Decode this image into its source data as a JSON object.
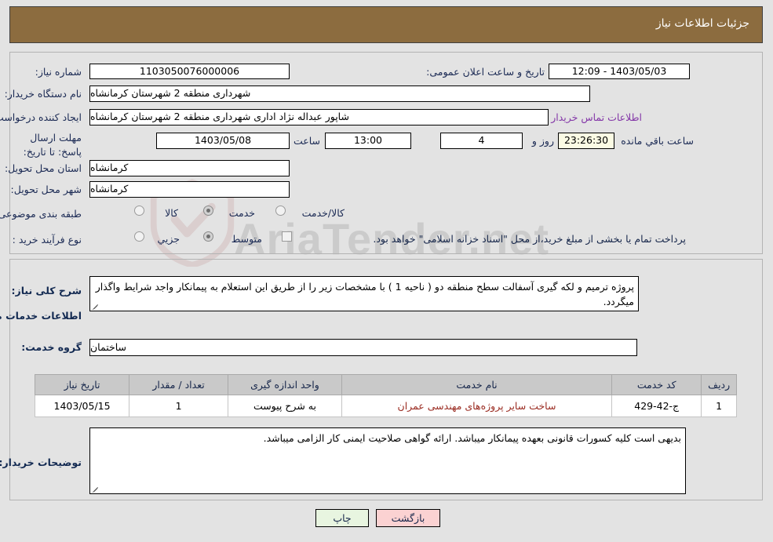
{
  "header": {
    "title": "جزئیات اطلاعات نیاز"
  },
  "form": {
    "need_number_label": "شماره نیاز:",
    "need_number_value": "1103050076000006",
    "public_announce_label": "تاریخ و ساعت اعلان عمومی:",
    "public_announce_value": "1403/05/03 - 12:09",
    "buyer_org_label": "نام دستگاه خریدار:",
    "buyer_org_value": "شهرداری منطقه 2 شهرستان کرمانشاه",
    "creator_label": "ایجاد کننده درخواست:",
    "creator_value": "شاپور عبداله نژاد اداری شهرداری منطقه 2 شهرستان کرمانشاه",
    "buyer_contact_link": "اطلاعات تماس خریدار",
    "deadline_label": "مهلت ارسال پاسخ: تا تاریخ:",
    "deadline_date": "1403/05/08",
    "hour_label": "ساعت",
    "deadline_time": "13:00",
    "days_remaining": "4",
    "days_label": "روز و",
    "time_remaining": "23:26:30",
    "remaining_suffix": "ساعت باقي مانده",
    "province_label": "استان محل تحویل:",
    "province_value": "کرمانشاه",
    "city_label": "شهر محل تحویل:",
    "city_value": "کرمانشاه",
    "category_label": "طبقه بندی موضوعی:",
    "category_options": [
      {
        "label": "کالا",
        "selected": false
      },
      {
        "label": "خدمت",
        "selected": true
      },
      {
        "label": "کالا/خدمت",
        "selected": false
      }
    ],
    "process_label": "نوع فرآیند خرید :",
    "process_options": [
      {
        "label": "جزیي",
        "selected": false
      },
      {
        "label": "متوسط",
        "selected": true
      }
    ],
    "treasury_checkbox_label": "پرداخت تمام یا بخشی از مبلغ خرید،از محل \"اسناد خزانه اسلامی\" خواهد بود.",
    "treasury_checked": false
  },
  "description": {
    "label": "شرح کلی نیاز:",
    "value": "پروژه ترمیم و لکه گیری آسفالت سطح منطقه دو ( ناحیه 1 )  با مشخصات زیر را از طریق این استعلام به پیمانکار واجد شرایط واگذار میگردد."
  },
  "services": {
    "section_title": "اطلاعات خدمات مورد نیاز",
    "group_label": "گروه خدمت:",
    "group_value": "ساختمان",
    "table": {
      "columns": [
        "ردیف",
        "کد خدمت",
        "نام خدمت",
        "واحد اندازه گیری",
        "تعداد / مقدار",
        "تاریخ نیاز"
      ],
      "rows": [
        {
          "row": "1",
          "code": "ج-42-429",
          "name": "ساخت سایر پروژه‌های مهندسی عمران",
          "unit": "به شرح پیوست",
          "qty": "1",
          "date": "1403/05/15"
        }
      ]
    }
  },
  "buyer_notes": {
    "label": "توضیحات خریدار:",
    "value": "بدیهی است کلیه کسورات قانونی بعهده پیمانکار میباشد.  ارائه گواهی صلاحیت ایمنی کار الزامی میباشد."
  },
  "footer": {
    "back_label": "بازگشت",
    "print_label": "چاپ"
  },
  "watermark": {
    "text": "AriaTender.net"
  },
  "colors": {
    "header_bar": "#8c6c3f",
    "link": "#8438a8",
    "label": "#1b2a54",
    "back_button": "#fbd2d2",
    "print_button": "#e8f5e0",
    "table_header": "#c9c9c9",
    "service_name": "#9a2b21"
  }
}
